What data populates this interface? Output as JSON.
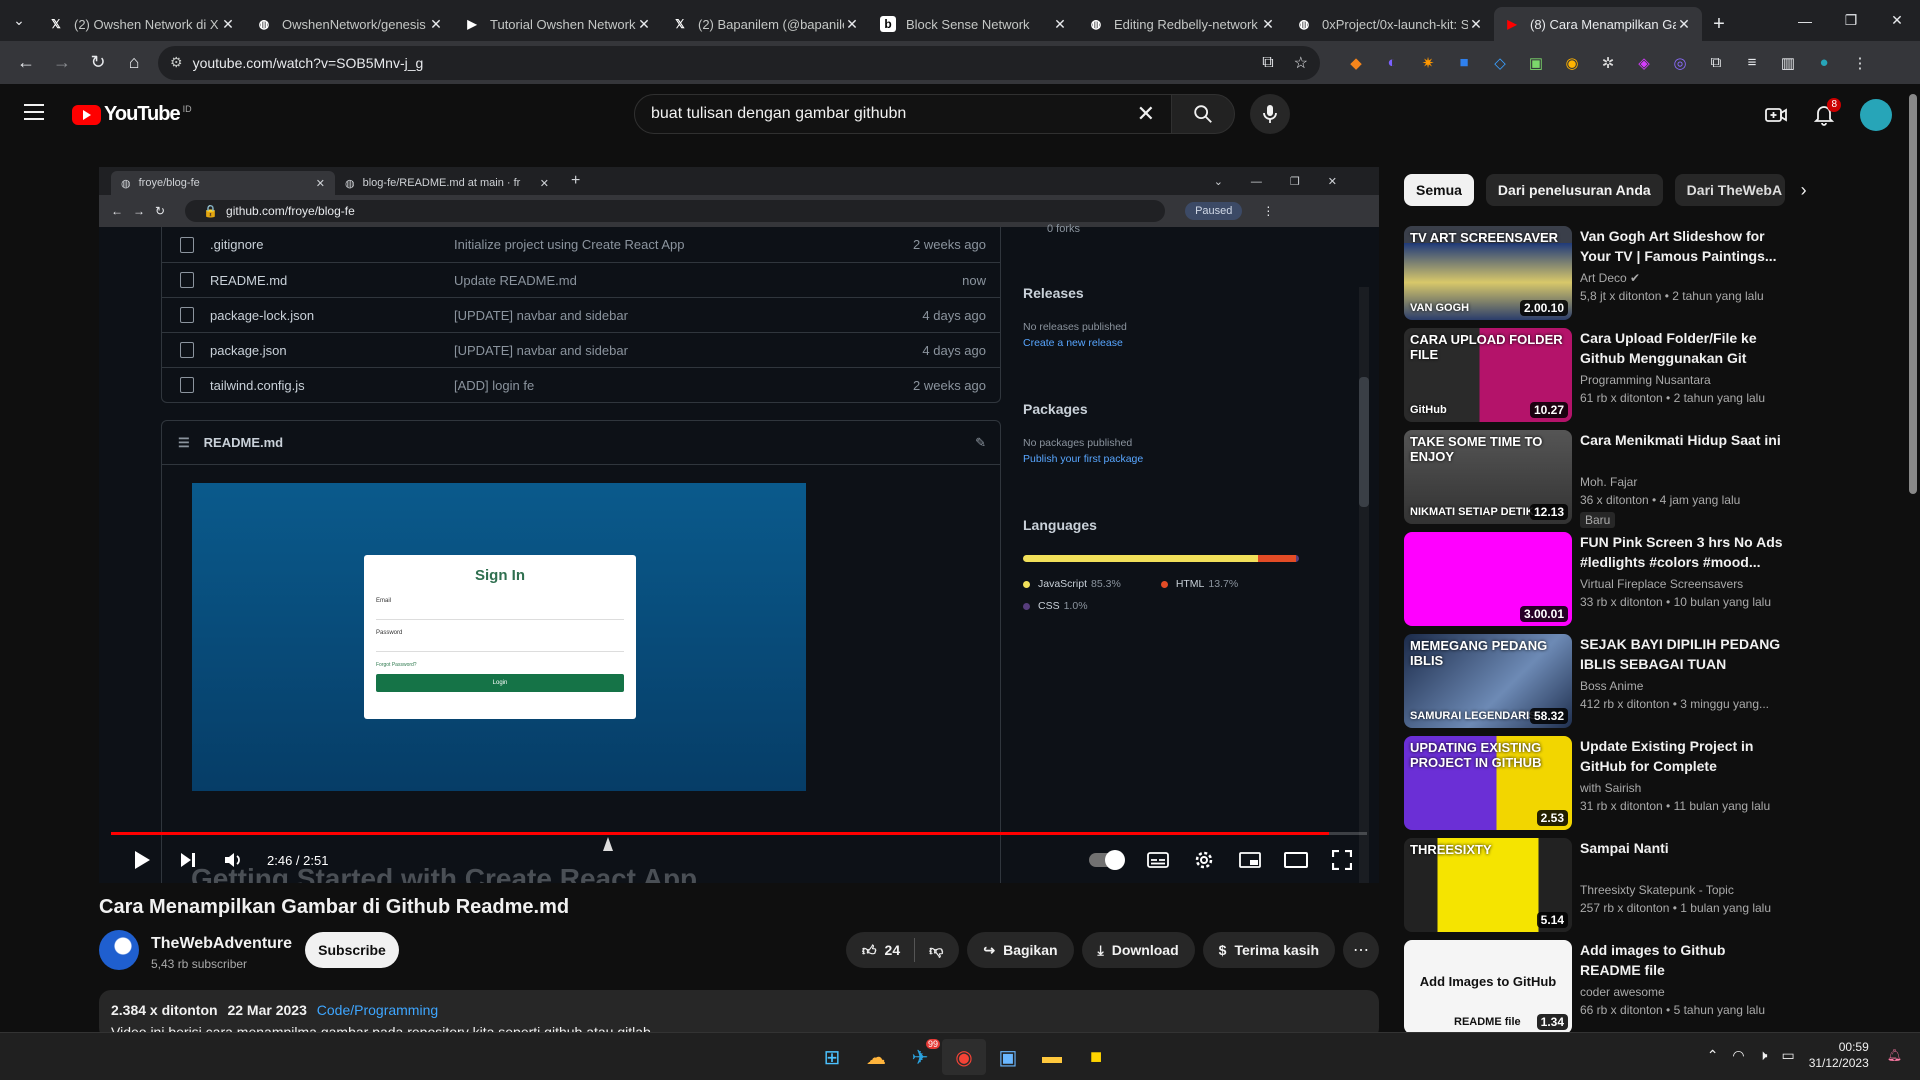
{
  "browser": {
    "tabs": [
      {
        "title": "(2) Owshen Network di X",
        "icon": "x-icon",
        "color": "#ffffff"
      },
      {
        "title": "OwshenNetwork/genesis",
        "icon": "github-icon",
        "color": "#ffffff"
      },
      {
        "title": "Tutorial Owshen Network",
        "icon": "video-icon",
        "color": "#ffffff"
      },
      {
        "title": "(2) Bapanilem (@bapanile",
        "icon": "x-icon",
        "color": "#ffffff"
      },
      {
        "title": "Block Sense Network",
        "icon": "b-icon",
        "color": "#ffffff"
      },
      {
        "title": "Editing Redbelly-network",
        "icon": "github-icon",
        "color": "#ffffff"
      },
      {
        "title": "0xProject/0x-launch-kit: S",
        "icon": "github-icon",
        "color": "#ffffff"
      },
      {
        "title": "(8) Cara Menampilkan Ga",
        "icon": "youtube-icon",
        "color": "#ff0000"
      }
    ],
    "url": "youtube.com/watch?v=SOB5Mnv-j_g"
  },
  "youtube": {
    "logo": "YouTube",
    "region": "ID",
    "search_query": "buat tulisan dengan gambar githubn",
    "notifications": "8"
  },
  "video_content": {
    "tabs": [
      "froye/blog-fe",
      "blog-fe/README.md at main · fr"
    ],
    "url": "github.com/froye/blog-fe",
    "paused": "Paused",
    "files": [
      {
        "name": ".gitignore",
        "msg": "Initialize project using Create React App",
        "date": "2 weeks ago"
      },
      {
        "name": "README.md",
        "msg": "Update README.md",
        "date": "now"
      },
      {
        "name": "package-lock.json",
        "msg": "[UPDATE] navbar and sidebar",
        "date": "4 days ago"
      },
      {
        "name": "package.json",
        "msg": "[UPDATE] navbar and sidebar",
        "date": "4 days ago"
      },
      {
        "name": "tailwind.config.js",
        "msg": "[ADD] login fe",
        "date": "2 weeks ago"
      }
    ],
    "readme_title": "README.md",
    "signin": {
      "title": "Sign In",
      "email": "Email",
      "password": "Password",
      "forgot": "Forgot Password?",
      "button": "Login"
    },
    "forks": "0 forks",
    "releases": {
      "title": "Releases",
      "none": "No releases published",
      "link": "Create a new release"
    },
    "packages": {
      "title": "Packages",
      "none": "No packages published",
      "link": "Publish your first package"
    },
    "languages": {
      "title": "Languages",
      "items": [
        {
          "name": "JavaScript",
          "pct": "85.3%",
          "value": 85.3,
          "color": "#f1e05a"
        },
        {
          "name": "HTML",
          "pct": "13.7%",
          "value": 13.7,
          "color": "#e34c26"
        },
        {
          "name": "CSS",
          "pct": "1.0%",
          "value": 1.0,
          "color": "#563d7c"
        }
      ]
    },
    "caption": "Getting Started with Create React App"
  },
  "player": {
    "time": "2:46 / 2:51",
    "progress": 0.97
  },
  "video": {
    "title": "Cara Menampilkan Gambar di Github Readme.md",
    "channel": "TheWebAdventure",
    "subscribers": "5,43 rb subscriber",
    "subscribe": "Subscribe",
    "likes": "24",
    "share": "Bagikan",
    "download": "Download",
    "thanks": "Terima kasih",
    "views": "2.384 x ditonton",
    "date": "22 Mar 2023",
    "category": "Code/Programming",
    "description": "Video ini berisi cara menampilma gambar pada repository kita seperti github atau gitlab."
  },
  "chips": [
    "Semua",
    "Dari penelusuran Anda",
    "Dari TheWebA"
  ],
  "recommendations": [
    {
      "title": "Van Gogh Art Slideshow for Your TV | Famous Paintings...",
      "channel": "Art Deco",
      "verified": "✔",
      "meta": "5,8 jt x ditonton • 2 tahun yang lalu",
      "duration": "2.00.10",
      "thumb_text": "TV ART SCREENSAVER",
      "thumb_sub": "VAN GOGH",
      "bg": "linear-gradient(180deg,#3a3f4a 0 18%,#1f3a7a 18%,#d8c86a 60%,#2b3d6b 100%)"
    },
    {
      "title": "Cara Upload Folder/File ke Github Menggunakan Git Bash...",
      "channel": "Programming Nusantara",
      "meta": "61 rb x ditonton • 2 tahun yang lalu",
      "duration": "10.27",
      "thumb_text": "CARA UPLOAD FOLDER FILE",
      "thumb_sub": "GitHub",
      "bg": "linear-gradient(90deg,#2a2a2a 0 45%,#b4136a 45%)"
    },
    {
      "title": "Cara Menikmati Hidup Saat ini",
      "channel": "Moh. Fajar",
      "meta": "36 x ditonton • 4 jam yang lalu",
      "badge": "Baru",
      "duration": "12.13",
      "thumb_text": "TAKE SOME TIME TO ENJOY",
      "thumb_sub": "NIKMATI SETIAP DETIK",
      "bg": "linear-gradient(180deg,#555,#333)"
    },
    {
      "title": "FUN Pink Screen 3 hrs No Ads #ledlights #colors #mood...",
      "channel": "Virtual Fireplace Screensavers",
      "meta": "33 rb x ditonton • 10 bulan yang lalu",
      "duration": "3.00.01",
      "thumb_text": "",
      "thumb_sub": "",
      "bg": "#ff00ff"
    },
    {
      "title": "SEJAK BAYI DIPILIH PEDANG IBLIS SEBAGAI TUAN SAMUR...",
      "channel": "Boss Anime",
      "meta": "412 rb x ditonton • 3 minggu yang...",
      "duration": "58.32",
      "thumb_text": "MEMEGANG PEDANG IBLIS",
      "thumb_sub": "SAMURAI LEGENDARIS",
      "bg": "linear-gradient(135deg,#1c2b4a,#6d8ab5 60%,#20304f)"
    },
    {
      "title": "Update Existing Project in GitHub for Complete Beginners",
      "channel": "with Sairish",
      "meta": "31 rb x ditonton • 11 bulan yang lalu",
      "duration": "2.53",
      "thumb_text": "UPDATING EXISTING PROJECT IN GITHUB",
      "thumb_sub": "",
      "bg": "linear-gradient(90deg,#6b2fd6 0 55%,#f2d600 55%)"
    },
    {
      "title": "Sampai Nanti",
      "channel": "Threesixty Skatepunk - Topic",
      "meta": "257 rb x ditonton • 1 bulan yang lalu",
      "duration": "5.14",
      "thumb_text": "THREESIXTY",
      "thumb_sub": "",
      "bg": "linear-gradient(90deg,#222 0 20%,#f5e400 20% 80%,#222 80%)"
    },
    {
      "title": "Add images to Github README file",
      "channel": "coder awesome",
      "meta": "66 rb x ditonton • 5 tahun yang lalu",
      "duration": "1.34",
      "thumb_text": "Add Images to GitHub",
      "thumb_sub": "README file",
      "bg": "#f5f5f5"
    }
  ],
  "taskbar": {
    "time": "00:59",
    "date": "31/12/2023",
    "telegram_badge": "99"
  }
}
